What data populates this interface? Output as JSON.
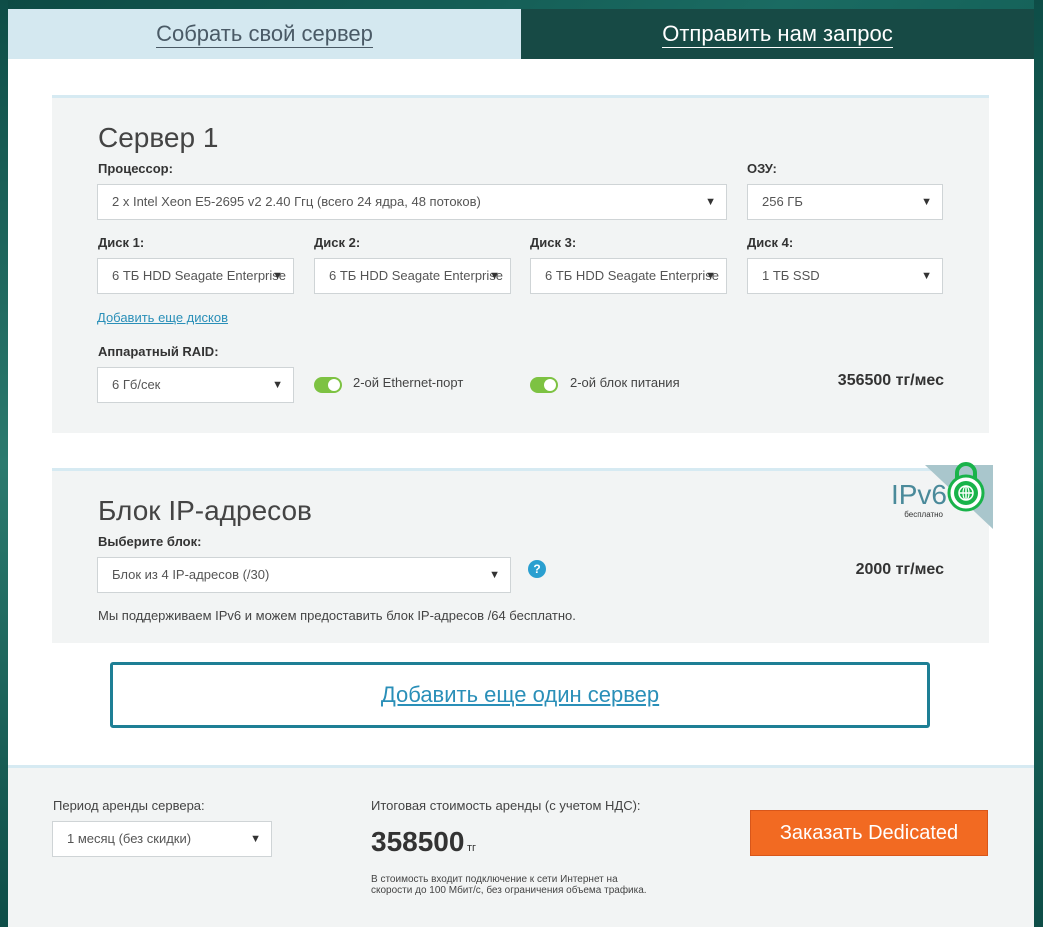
{
  "tabs": {
    "build": "Собрать свой сервер",
    "request": "Отправить нам запрос"
  },
  "server": {
    "title": "Сервер 1",
    "cpu_label": "Процессор:",
    "cpu_value": "2 x Intel Xeon E5-2695 v2 2.40 Ггц (всего 24 ядра, 48 потоков)",
    "ram_label": "ОЗУ:",
    "ram_value": "256 ГБ",
    "disks": [
      {
        "label": "Диск 1:",
        "value": "6 ТБ HDD Seagate Enterprise"
      },
      {
        "label": "Диск 2:",
        "value": "6 ТБ HDD Seagate Enterprise"
      },
      {
        "label": "Диск 3:",
        "value": "6 ТБ HDD Seagate Enterprise"
      },
      {
        "label": "Диск 4:",
        "value": "1 ТБ SSD"
      }
    ],
    "add_disks_link": "Добавить еще дисков",
    "raid_label": "Аппаратный RAID:",
    "raid_value": "6 Гб/сек",
    "ethernet_label": "2-ой Ethernet-порт",
    "ethernet_enabled": true,
    "power_label": "2-ой блок питания",
    "power_enabled": true,
    "price": "356500 тг/мес"
  },
  "ip_block": {
    "title": "Блок IP-адресов",
    "badge_text": "IPv6",
    "badge_sub": "бесплатно",
    "select_label": "Выберите блок:",
    "select_value": "Блок из 4 IP-адресов (/30)",
    "help_glyph": "?",
    "note": "Мы поддерживаем IPv6 и можем предоставить блок IP-адресов /64 бесплатно.",
    "price": "2000 тг/мес"
  },
  "add_server_label": "Добавить еще один сервер",
  "footer": {
    "period_label": "Период аренды сервера:",
    "period_value": "1 месяц (без скидки)",
    "total_label": "Итоговая стоимость аренды (с учетом НДС):",
    "total_value": "358500",
    "total_unit": "тг",
    "total_note": "В стоимость входит подключение к сети Интернет на скорости до 100 Мбит/с, без ограничения объема трафика.",
    "order_button": "Заказать Dedicated"
  },
  "colors": {
    "accent_link": "#2a8fb8",
    "toggle_on": "#7dc242",
    "order_button": "#f26a22",
    "tab_active_bg": "#d4e8f0",
    "tab_inactive_bg": "#174a45"
  },
  "icons": {
    "chevron": "chevron-down-icon",
    "ipv6_lock": "globe-lock-icon",
    "help": "help-icon"
  }
}
